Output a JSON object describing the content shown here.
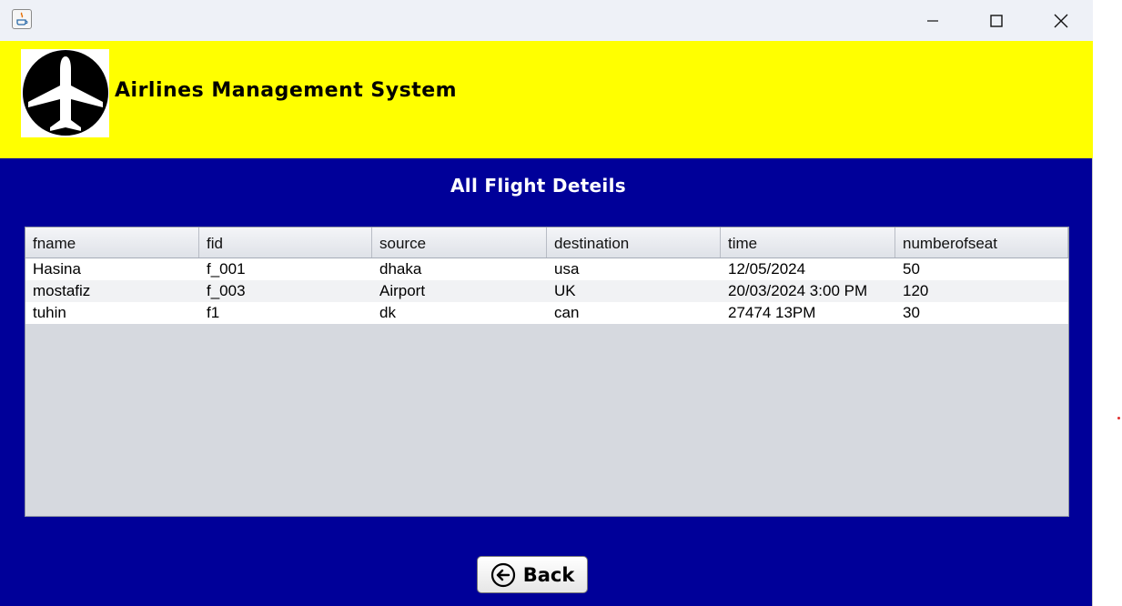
{
  "window": {
    "controls": [
      "minimize-icon",
      "maximize-icon",
      "close-icon"
    ]
  },
  "header": {
    "title": "Airlines Management System",
    "background": "#ffff00",
    "logo_icon": "airplane-icon"
  },
  "main": {
    "title": "All Flight Deteils",
    "background": "#000099"
  },
  "table": {
    "columns": [
      "fname",
      "fid",
      "source",
      "destination",
      "time",
      "numberofseat"
    ],
    "rows": [
      [
        "Hasina",
        "f_001",
        "dhaka",
        "usa",
        "12/05/2024",
        "50"
      ],
      [
        "mostafiz",
        "f_003",
        "Airport",
        "UK",
        "20/03/2024 3:00 PM",
        "120"
      ],
      [
        "tuhin",
        "f1",
        "dk",
        "can",
        "27474 13PM",
        "30"
      ]
    ]
  },
  "footer": {
    "back_label": "Back",
    "back_icon": "arrow-left-circle-icon"
  }
}
